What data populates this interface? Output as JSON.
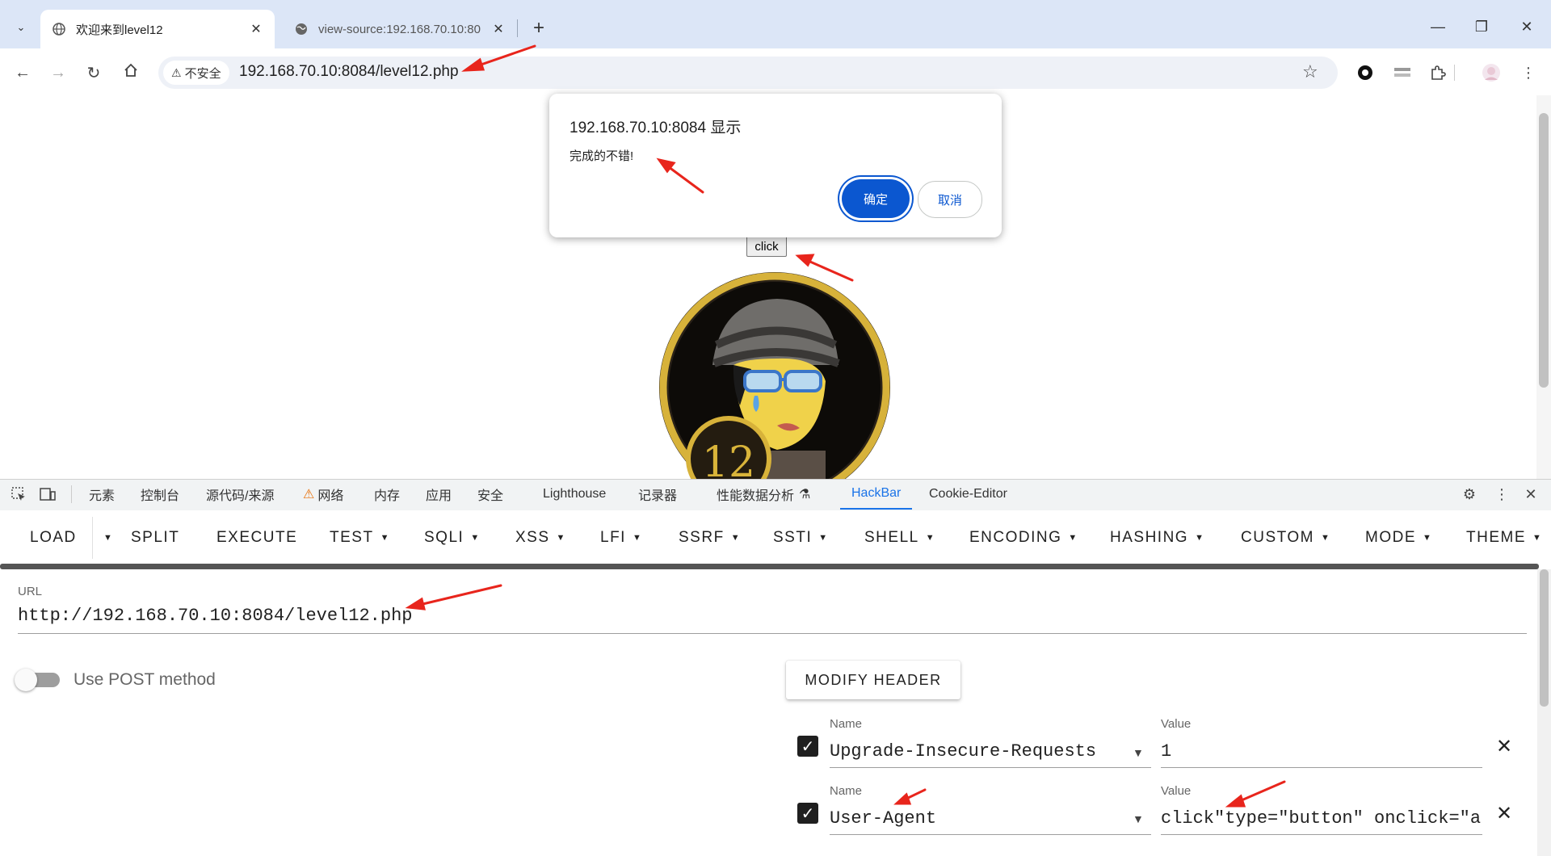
{
  "browser": {
    "tabs": [
      {
        "title": "欢迎来到level12",
        "active": true
      },
      {
        "title": "view-source:192.168.70.10:80",
        "active": false
      }
    ],
    "security_label": "不安全",
    "address": "192.168.70.10:8084/level12.php"
  },
  "page": {
    "button_label": "click",
    "badge_number": "12"
  },
  "dialog": {
    "title": "192.168.70.10:8084 显示",
    "message": "完成的不错!",
    "ok_label": "确定",
    "cancel_label": "取消"
  },
  "devtools": {
    "tabs": [
      "元素",
      "控制台",
      "源代码/来源",
      "网络",
      "内存",
      "应用",
      "安全",
      "Lighthouse",
      "记录器",
      "性能数据分析",
      "HackBar",
      "Cookie-Editor"
    ],
    "active_tab": "HackBar"
  },
  "hackbar": {
    "menu": [
      "LOAD",
      "SPLIT",
      "EXECUTE",
      "TEST",
      "SQLI",
      "XSS",
      "LFI",
      "SSRF",
      "SSTI",
      "SHELL",
      "ENCODING",
      "HASHING",
      "CUSTOM",
      "MODE",
      "THEME"
    ],
    "url_label": "URL",
    "url_value": "http://192.168.70.10:8084/level12.php",
    "post_toggle_label": "Use POST method",
    "post_enabled": false,
    "modify_header_label": "MODIFY HEADER",
    "headers": [
      {
        "name_label": "Name",
        "name": "Upgrade-Insecure-Requests",
        "value_label": "Value",
        "value": "1",
        "enabled": true
      },
      {
        "name_label": "Name",
        "name": "User-Agent",
        "value_label": "Value",
        "value": "click\"type=\"button\" onclick=\"a",
        "enabled": true
      }
    ]
  },
  "colors": {
    "accent": "#1a73e8",
    "dialog_ok": "#0b57d0",
    "annotation_arrow": "#e8251c",
    "tabstrip": "#dce6f7"
  }
}
